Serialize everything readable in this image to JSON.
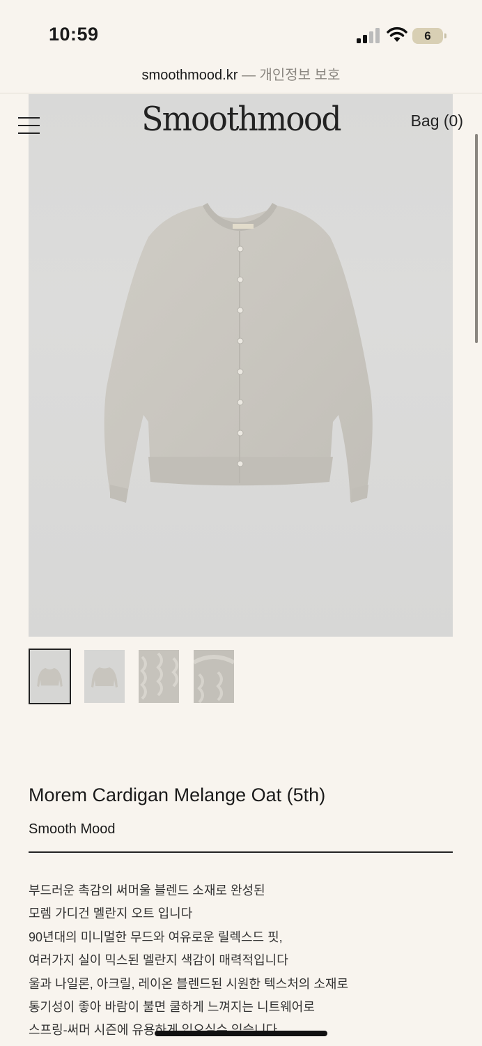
{
  "status_bar": {
    "time": "10:59",
    "battery_level": "6",
    "icons": [
      "signal-icon",
      "wifi-icon",
      "battery-icon"
    ]
  },
  "url_bar": {
    "domain": "smoothmood.kr",
    "separator": "—",
    "privacy": "개인정보 보호"
  },
  "header": {
    "logo": "Smoothmood",
    "bag": "Bag (0)",
    "menu_icon": "hamburger-menu-icon"
  },
  "gallery": {
    "thumbnail_count": 4,
    "active_index": 0
  },
  "product": {
    "title": "Morem Cardigan Melange Oat (5th)",
    "brand": "Smooth Mood",
    "description": [
      "부드러운 촉감의 써머울 블렌드 소재로 완성된",
      "모렘 가디건 멜란지 오트 입니다",
      "90년대의 미니멀한 무드와 여유로운 릴렉스드 핏,",
      "여러가지 실이 믹스된 멜란지 색감이 매력적입니다",
      "울과 나일론, 아크릴, 레이온 블렌드된 시원한 텍스처의 소재로",
      "통기성이 좋아 바람이 불면 쿨하게 느껴지는 니트웨어로",
      "스프링-써머 시즌에 유용하게 입으실수 있습니다"
    ]
  },
  "colors": {
    "background": "#f8f4ee",
    "text": "#1a1a1a",
    "product_oat": "#c9c6bf"
  }
}
